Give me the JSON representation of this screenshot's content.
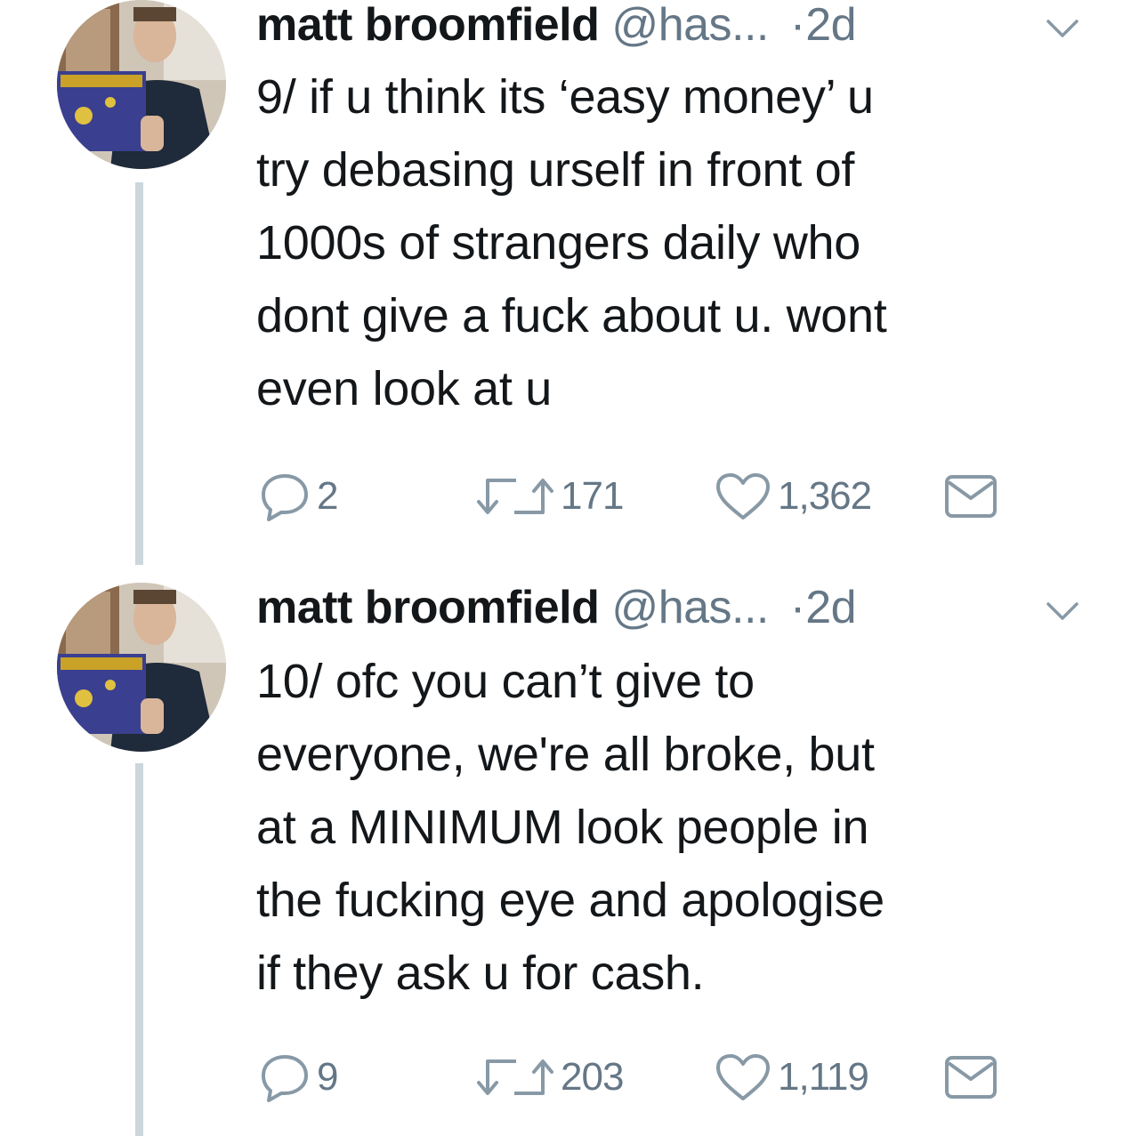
{
  "tweets": [
    {
      "name": "matt broomfield",
      "handle": "@has...",
      "dot": "·",
      "time": "2d",
      "text": "9/ if u think its ‘easy money’ u\ntry debasing urself in front of\n1000s of strangers daily who\ndont give a fuck about u. wont\neven look at u",
      "replies": "2",
      "retweets": "171",
      "likes": "1,362"
    },
    {
      "name": "matt broomfield",
      "handle": "@has...",
      "dot": "·",
      "time": "2d",
      "text": "10/ ofc you can’t give to\neveryone, we're all broke, but\nat a MINIMUM look people in\nthe fucking eye and apologise\nif they ask u for cash.",
      "replies": "9",
      "retweets": "203",
      "likes": "1,119"
    }
  ],
  "icons": {
    "reply": "reply-icon",
    "retweet": "retweet-icon",
    "like": "heart-icon",
    "dm": "envelope-icon",
    "more": "chevron-down-icon"
  },
  "colors": {
    "text": "#14171a",
    "muted": "#657786",
    "thread_line": "#ccd6dd"
  }
}
